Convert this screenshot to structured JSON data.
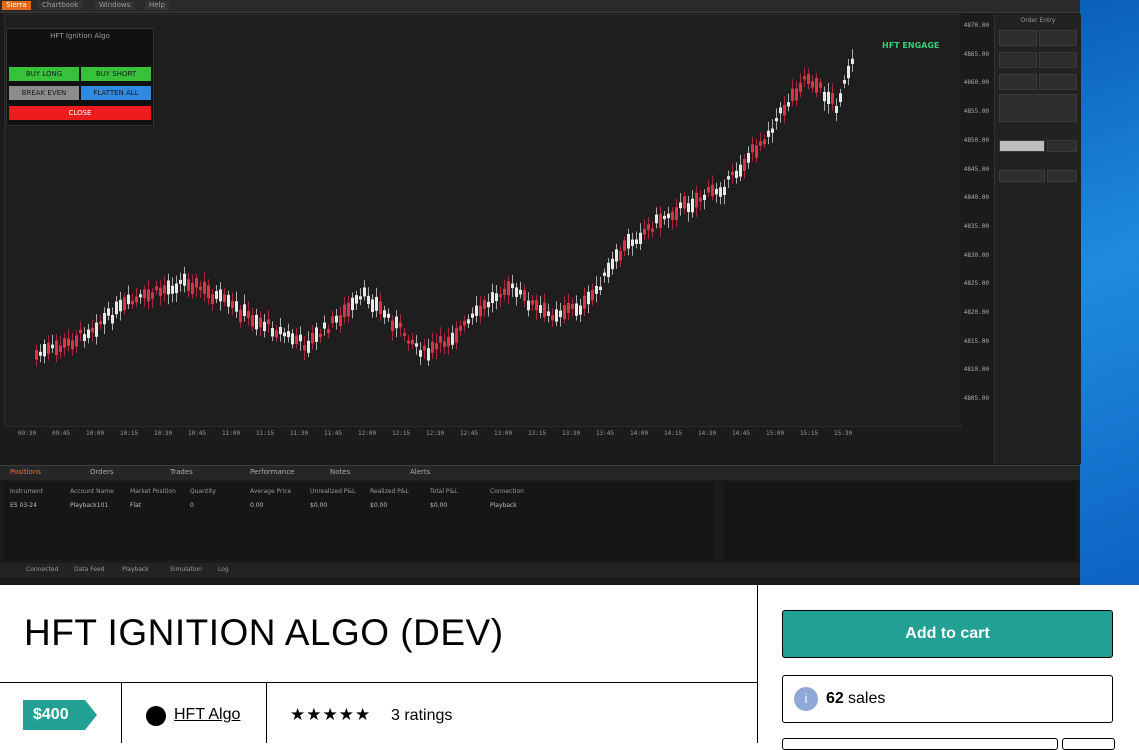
{
  "product": {
    "title": "HFT IGNITION ALGO (DEV)",
    "price": "$400",
    "seller": "HFT Algo",
    "stars": "★★★★★",
    "ratings": "3 ratings",
    "add_to_cart": "Add to cart",
    "sales_count": "62",
    "sales_label": "sales",
    "sales_icon": "i"
  },
  "trading": {
    "logo": "Sierra",
    "top_menu": [
      "Chartbook",
      "Windows",
      "Help"
    ],
    "status_label": "HFT ENGAGE",
    "panel_title": "HFT Ignition Algo",
    "panel_buttons": {
      "buy_long": "BUY LONG",
      "buy_short": "BUY SHORT",
      "break_even": "BREAK EVEN",
      "flatten": "FLATTEN ALL",
      "close": "CLOSE"
    },
    "lower_tabs": [
      "Positions",
      "Orders",
      "Trades",
      "Performance",
      "Notes",
      "Alerts"
    ],
    "table_headers": [
      "Instrument",
      "Account Name",
      "Market Position",
      "Quantity",
      "Average Price",
      "Unrealized P&L",
      "Realized P&L",
      "Total P&L",
      "Connection"
    ],
    "table_row": [
      "ES 03-24",
      "Playback101",
      "Flat",
      "0",
      "0.00",
      "$0.00",
      "$0.00",
      "$0.00",
      "Playback"
    ],
    "right_panel_title": "Order Entry",
    "price_ticks": [
      "4870.00",
      "4865.00",
      "4860.00",
      "4855.00",
      "4850.00",
      "4845.00",
      "4840.00",
      "4835.00",
      "4830.00",
      "4825.00",
      "4820.00",
      "4815.00",
      "4810.00",
      "4805.00"
    ],
    "time_ticks": [
      "09:30",
      "09:45",
      "10:00",
      "10:15",
      "10:30",
      "10:45",
      "11:00",
      "11:15",
      "11:30",
      "11:45",
      "12:00",
      "12:15",
      "12:30",
      "12:45",
      "13:00",
      "13:15",
      "13:30",
      "13:45",
      "14:00",
      "14:15",
      "14:30",
      "14:45",
      "15:00",
      "15:15",
      "15:30"
    ],
    "status_tabs": [
      "Connected",
      "Data Feed",
      "Playback",
      "Simulation",
      "Log"
    ]
  },
  "colors": {
    "accent": "#23a094",
    "bull": "#e8e8e8",
    "bear": "#e0304a",
    "engage": "#33d17a"
  }
}
